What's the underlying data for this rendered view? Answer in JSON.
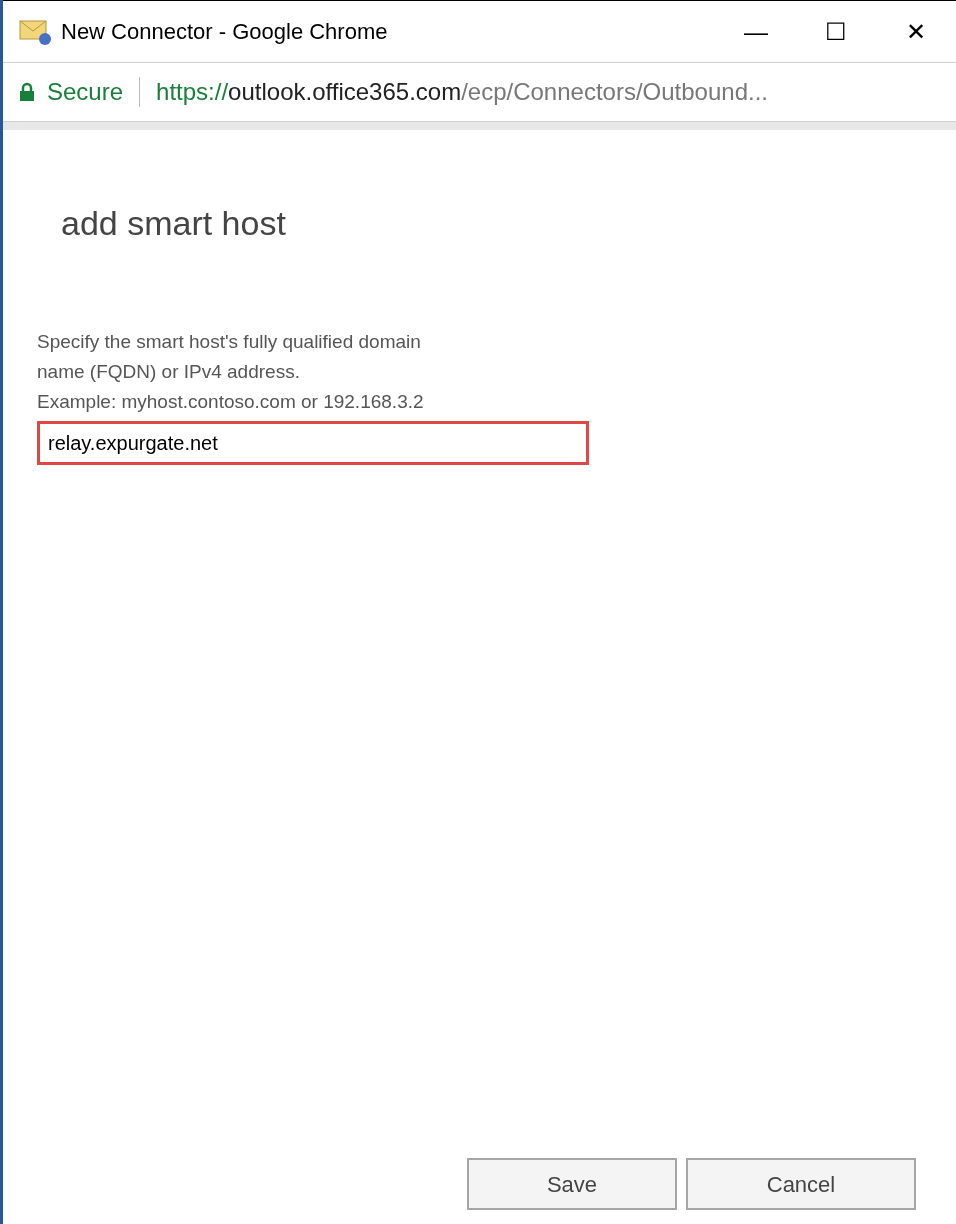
{
  "window": {
    "title": "New Connector - Google Chrome",
    "controls": [
      "—",
      "☐",
      "✕"
    ]
  },
  "address_bar": {
    "security": "Secure",
    "scheme": "https://",
    "host": "outlook.office365.com",
    "path": "/ecp/Connectors/Outbound..."
  },
  "dialog": {
    "heading": "add smart host",
    "description": [
      "Specify the smart host's fully qualified domain",
      "name (FQDN) or IPv4 address.",
      "Example: myhost.contoso.com or 192.168.3.2"
    ],
    "field": {
      "value": "relay.expurgate.net",
      "highlighted": true
    },
    "buttons": [
      "Save",
      "Cancel"
    ]
  }
}
